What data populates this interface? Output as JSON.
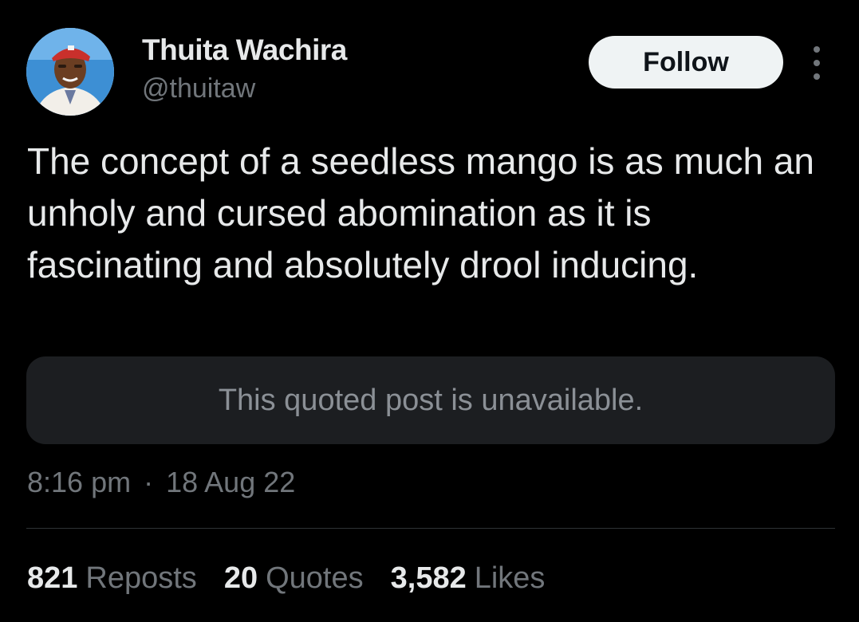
{
  "author": {
    "name": "Thuita Wachira",
    "handle": "@thuitaw"
  },
  "actions": {
    "follow_label": "Follow",
    "more_icon": "more-vertical-icon"
  },
  "post": {
    "text": "The concept of a seedless mango is as much an unholy and cursed abomination as it is fascinating and absolutely drool inducing.",
    "quote_placeholder": "This quoted post is unavailable.",
    "time": "8:16 pm",
    "separator": "·",
    "date": "18 Aug 22"
  },
  "stats": {
    "reposts": {
      "count": "821",
      "label": "Reposts"
    },
    "quotes": {
      "count": "20",
      "label": "Quotes"
    },
    "likes": {
      "count": "3,582",
      "label": "Likes"
    }
  },
  "colors": {
    "background": "#000000",
    "primary_text": "#e7e9ea",
    "secondary_text": "#71767b",
    "follow_button_bg": "#eff3f4",
    "quote_box_bg": "#1c1e21",
    "divider": "#2f3336"
  }
}
